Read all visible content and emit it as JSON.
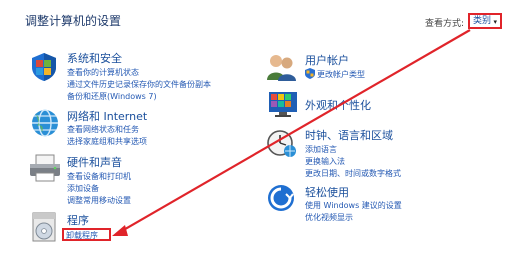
{
  "header": {
    "title": "调整计算机的设置",
    "view_label": "查看方式:",
    "view_value": "类别"
  },
  "categories": {
    "system": {
      "title": "系统和安全",
      "links": [
        "查看你的计算机状态",
        "通过文件历史记录保存你的文件备份副本",
        "备份和还原(Windows 7)"
      ]
    },
    "network": {
      "title": "网络和 Internet",
      "links": [
        "查看网络状态和任务",
        "选择家庭组和共享选项"
      ]
    },
    "hardware": {
      "title": "硬件和声音",
      "links": [
        "查看设备和打印机",
        "添加设备",
        "调整常用移动设置"
      ]
    },
    "programs": {
      "title": "程序",
      "links": [
        "卸载程序"
      ]
    },
    "user": {
      "title": "用户帐户",
      "links": [
        "更改帐户类型"
      ]
    },
    "appearance": {
      "title": "外观和个性化",
      "links": []
    },
    "clock": {
      "title": "时钟、语言和区域",
      "links": [
        "添加语言",
        "更换输入法",
        "更改日期、时间或数字格式"
      ]
    },
    "ease": {
      "title": "轻松使用",
      "links": [
        "使用 Windows 建议的设置",
        "优化视频显示"
      ]
    }
  },
  "colors": {
    "link": "#2459b3",
    "title": "#1a4f9c",
    "highlight": "#e0242a"
  }
}
